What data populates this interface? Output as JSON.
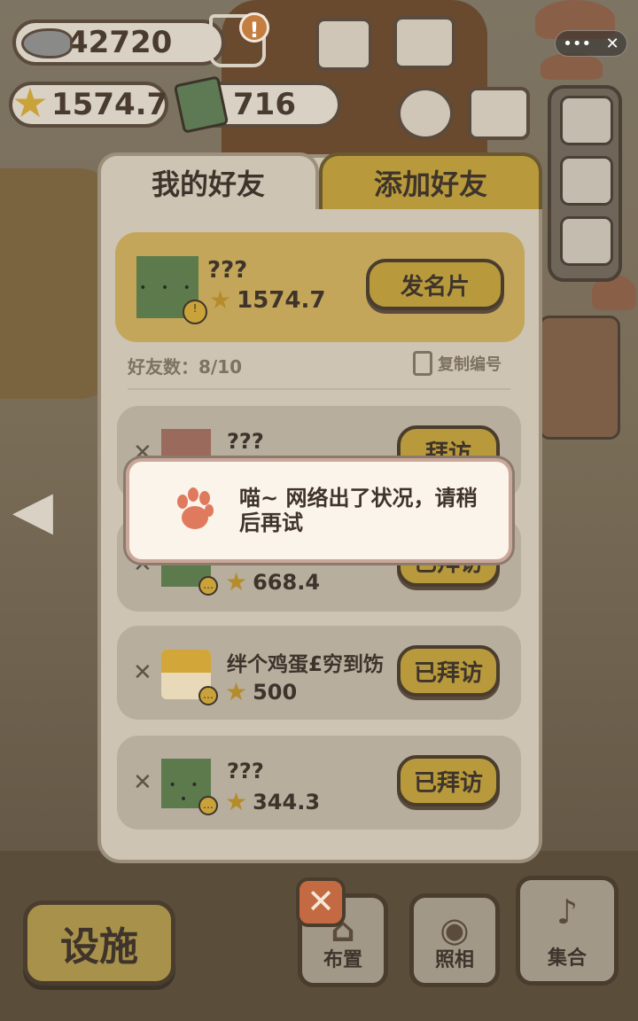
{
  "hud": {
    "fish_count": "42720",
    "star_count": "1574.7",
    "ticket_count": "716",
    "alert_badge": "!"
  },
  "window_controls": {
    "more": "•••",
    "close": "✕"
  },
  "friends_panel": {
    "tabs": [
      {
        "label": "我的好友",
        "active": true
      },
      {
        "label": "添加好友",
        "active": false
      }
    ],
    "me": {
      "name": "???",
      "score": "1574.7",
      "action_label": "发名片"
    },
    "friend_count_label": "好友数：8/10",
    "copy_id_label": "复制编号",
    "friends": [
      {
        "name": "???",
        "score": "",
        "action_label": "拜访"
      },
      {
        "name": "",
        "score": "668.4",
        "action_label": "已拜访"
      },
      {
        "name": "绊个鸡蛋£穷到饬",
        "score": "500",
        "action_label": "已拜访"
      },
      {
        "name": "???",
        "score": "344.3",
        "action_label": "已拜访"
      }
    ]
  },
  "toast": {
    "message": "喵~ 网络出了状况，请稍后再试"
  },
  "bottom_bar": {
    "facility_label": "设施",
    "layout_label": "布置",
    "photo_label": "照相",
    "gather_label": "集合",
    "close_symbol": "✕"
  },
  "colors": {
    "accent_gold": "#b89a3c",
    "panel_bg": "#cdc4b3",
    "toast_bg": "#fbf4ea",
    "paw": "#e07a5f"
  }
}
